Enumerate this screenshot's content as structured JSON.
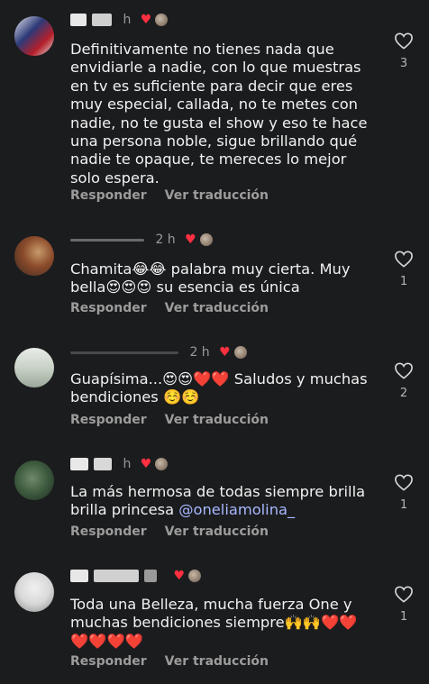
{
  "ui": {
    "reply_label": "Responder",
    "translate_label": "Ver traducción"
  },
  "comments": [
    {
      "time": "h",
      "text": "Definitivamente no tienes nada que envidiarle a nadie, con lo que muestras en tv es suficiente para decir que eres muy especial, callada, no te metes con nadie, no te gusta el show y eso te hace una persona noble, sigue brillando qué nadie te opaque, te mereces lo mejor solo espera.",
      "likes": "3"
    },
    {
      "time": "2 h",
      "text": "Chamita😂😂 palabra muy cierta. Muy bella😍😍😍 su esencia es única",
      "likes": "1"
    },
    {
      "time": "2 h",
      "text": "Guapísima...😍😍❤️❤️ Saludos y muchas bendiciones ☺️☺️",
      "likes": "2"
    },
    {
      "time": "h",
      "text_before": "La más hermosa de todas siempre brilla brilla princesa ",
      "mention": "@oneliamolina_",
      "likes": "1"
    },
    {
      "time": "",
      "text": "Toda una Belleza, mucha fuerza One y muchas bendiciones siempre🙌🙌❤️❤️❤️❤️❤️❤️",
      "likes": "1"
    }
  ]
}
